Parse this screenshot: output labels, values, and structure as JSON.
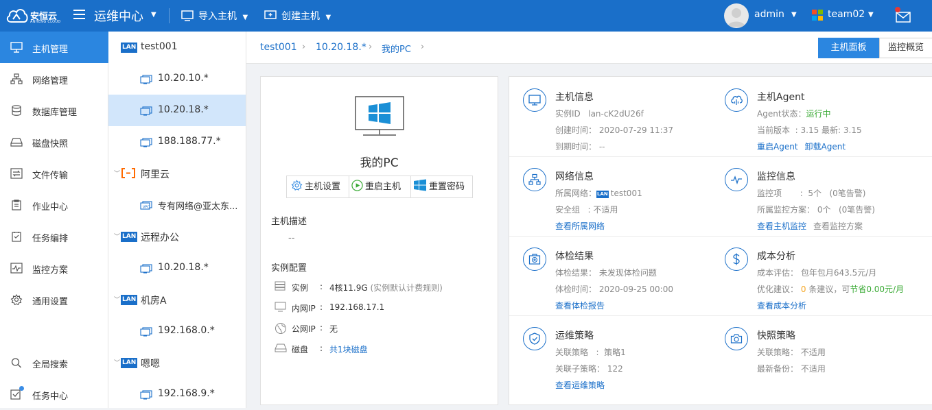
{
  "topbar": {
    "logo_text": "安恒云",
    "logo_sub": "ANHENG CLOUD",
    "app_title": "运维中心",
    "import_label": "导入主机",
    "create_label": "创建主机",
    "username": "admin",
    "team": "team02",
    "brand_color": "#1a6fc9"
  },
  "sidebar": {
    "items": [
      {
        "label": "主机管理",
        "icon": "monitor-icon"
      },
      {
        "label": "网络管理",
        "icon": "network-icon"
      },
      {
        "label": "数据库管理",
        "icon": "database-icon"
      },
      {
        "label": "磁盘快照",
        "icon": "disk-icon"
      },
      {
        "label": "文件传输",
        "icon": "transfer-icon"
      },
      {
        "label": "作业中心",
        "icon": "clipboard-icon"
      },
      {
        "label": "任务编排",
        "icon": "schedule-icon"
      },
      {
        "label": "监控方案",
        "icon": "pulse-icon"
      },
      {
        "label": "通用设置",
        "icon": "gear-icon"
      }
    ],
    "bottom": [
      {
        "label": "全局搜索",
        "icon": "search-icon"
      },
      {
        "label": "任务中心",
        "icon": "task-icon"
      }
    ]
  },
  "tree": {
    "nodes": [
      {
        "type": "group",
        "badge": "LAN",
        "label": "test001"
      },
      {
        "type": "child",
        "label": "10.20.10.*"
      },
      {
        "type": "child",
        "label": "10.20.18.*",
        "selected": true
      },
      {
        "type": "child",
        "label": "188.188.77.*"
      },
      {
        "type": "group",
        "badge": "aliyun",
        "label": "阿里云"
      },
      {
        "type": "child",
        "label": "专有网络@亚太东...",
        "vpc": true
      },
      {
        "type": "group",
        "badge": "LAN",
        "label": "远程办公"
      },
      {
        "type": "child",
        "label": "10.20.18.*"
      },
      {
        "type": "group",
        "badge": "LAN",
        "label": "机房A"
      },
      {
        "type": "child",
        "label": "192.168.0.*"
      },
      {
        "type": "group",
        "badge": "LAN",
        "label": "嗯嗯"
      },
      {
        "type": "child",
        "label": "192.168.9.*"
      }
    ]
  },
  "breadcrumb": [
    "test001",
    "10.20.18.*",
    "我的PC"
  ],
  "view_tabs": {
    "host_panel": "主机面板",
    "monitor_overview": "监控概览"
  },
  "host": {
    "name": "我的PC",
    "actions": {
      "settings": "主机设置",
      "restart": "重启主机",
      "reset_pwd": "重置密码"
    },
    "desc_title": "主机描述",
    "desc_value": "--",
    "config_title": "实例配置",
    "config": {
      "instance_label": "实例",
      "instance_value": "4核11.9G",
      "instance_note": "(实例默认计费规则)",
      "private_ip_label": "内网IP",
      "private_ip_value": "192.168.17.1",
      "public_ip_label": "公网IP",
      "public_ip_value": "无",
      "disk_label": "磁盘",
      "disk_value": "共1块磁盘",
      "colon": ":"
    }
  },
  "cards": {
    "host_info": {
      "title": "主机信息",
      "id_label": "实例ID",
      "id_value": "lan-cK2dU26f",
      "created_label": "创建时间：",
      "created_value": "2020-07-29 11:37",
      "expire_label": "到期时间：",
      "expire_value": "--"
    },
    "agent": {
      "title": "主机Agent",
      "status_label": "Agent状态：",
      "status_value": "运行中",
      "version_label": "当前版本",
      "version_value": "3.15 最新: 3.15",
      "restart_link": "重启Agent",
      "uninstall_link": "卸载Agent"
    },
    "network": {
      "title": "网络信息",
      "net_label": "所属网络：",
      "net_badge": "LAN",
      "net_value": "test001",
      "sg_label": "安全组",
      "sg_value": "不适用",
      "link": "查看所属网络"
    },
    "monitor": {
      "title": "监控信息",
      "items_label": "监控项",
      "items_value": "5个",
      "items_note": "(0笔告警)",
      "plan_label": "所属监控方案：",
      "plan_value": "0个",
      "plan_note": "(0笔告警)",
      "link1": "查看主机监控",
      "link2": "查看监控方案"
    },
    "check": {
      "title": "体检结果",
      "result_label": "体检结果：",
      "result_value": "未发现体检问题",
      "time_label": "体检时间：",
      "time_value": "2020-09-25 00:00",
      "link": "查看体检报告"
    },
    "cost": {
      "title": "成本分析",
      "eval_label": "成本评估：",
      "eval_value": "包年包月643.5元/月",
      "advice_label": "优化建议：",
      "advice_count": "0",
      "advice_mid": "条建议，可",
      "advice_save": "节省0.00元/月",
      "link": "查看成本分析"
    },
    "ops": {
      "title": "运维策略",
      "rel_label": "关联策略",
      "rel_value": "策略1",
      "sub_label": "关联子策略：",
      "sub_value": "122",
      "link": "查看运维策略"
    },
    "snapshot": {
      "title": "快照策略",
      "rel_label": "关联策略：",
      "rel_value": "不适用",
      "backup_label": "最新备份：",
      "backup_value": "不适用"
    }
  }
}
